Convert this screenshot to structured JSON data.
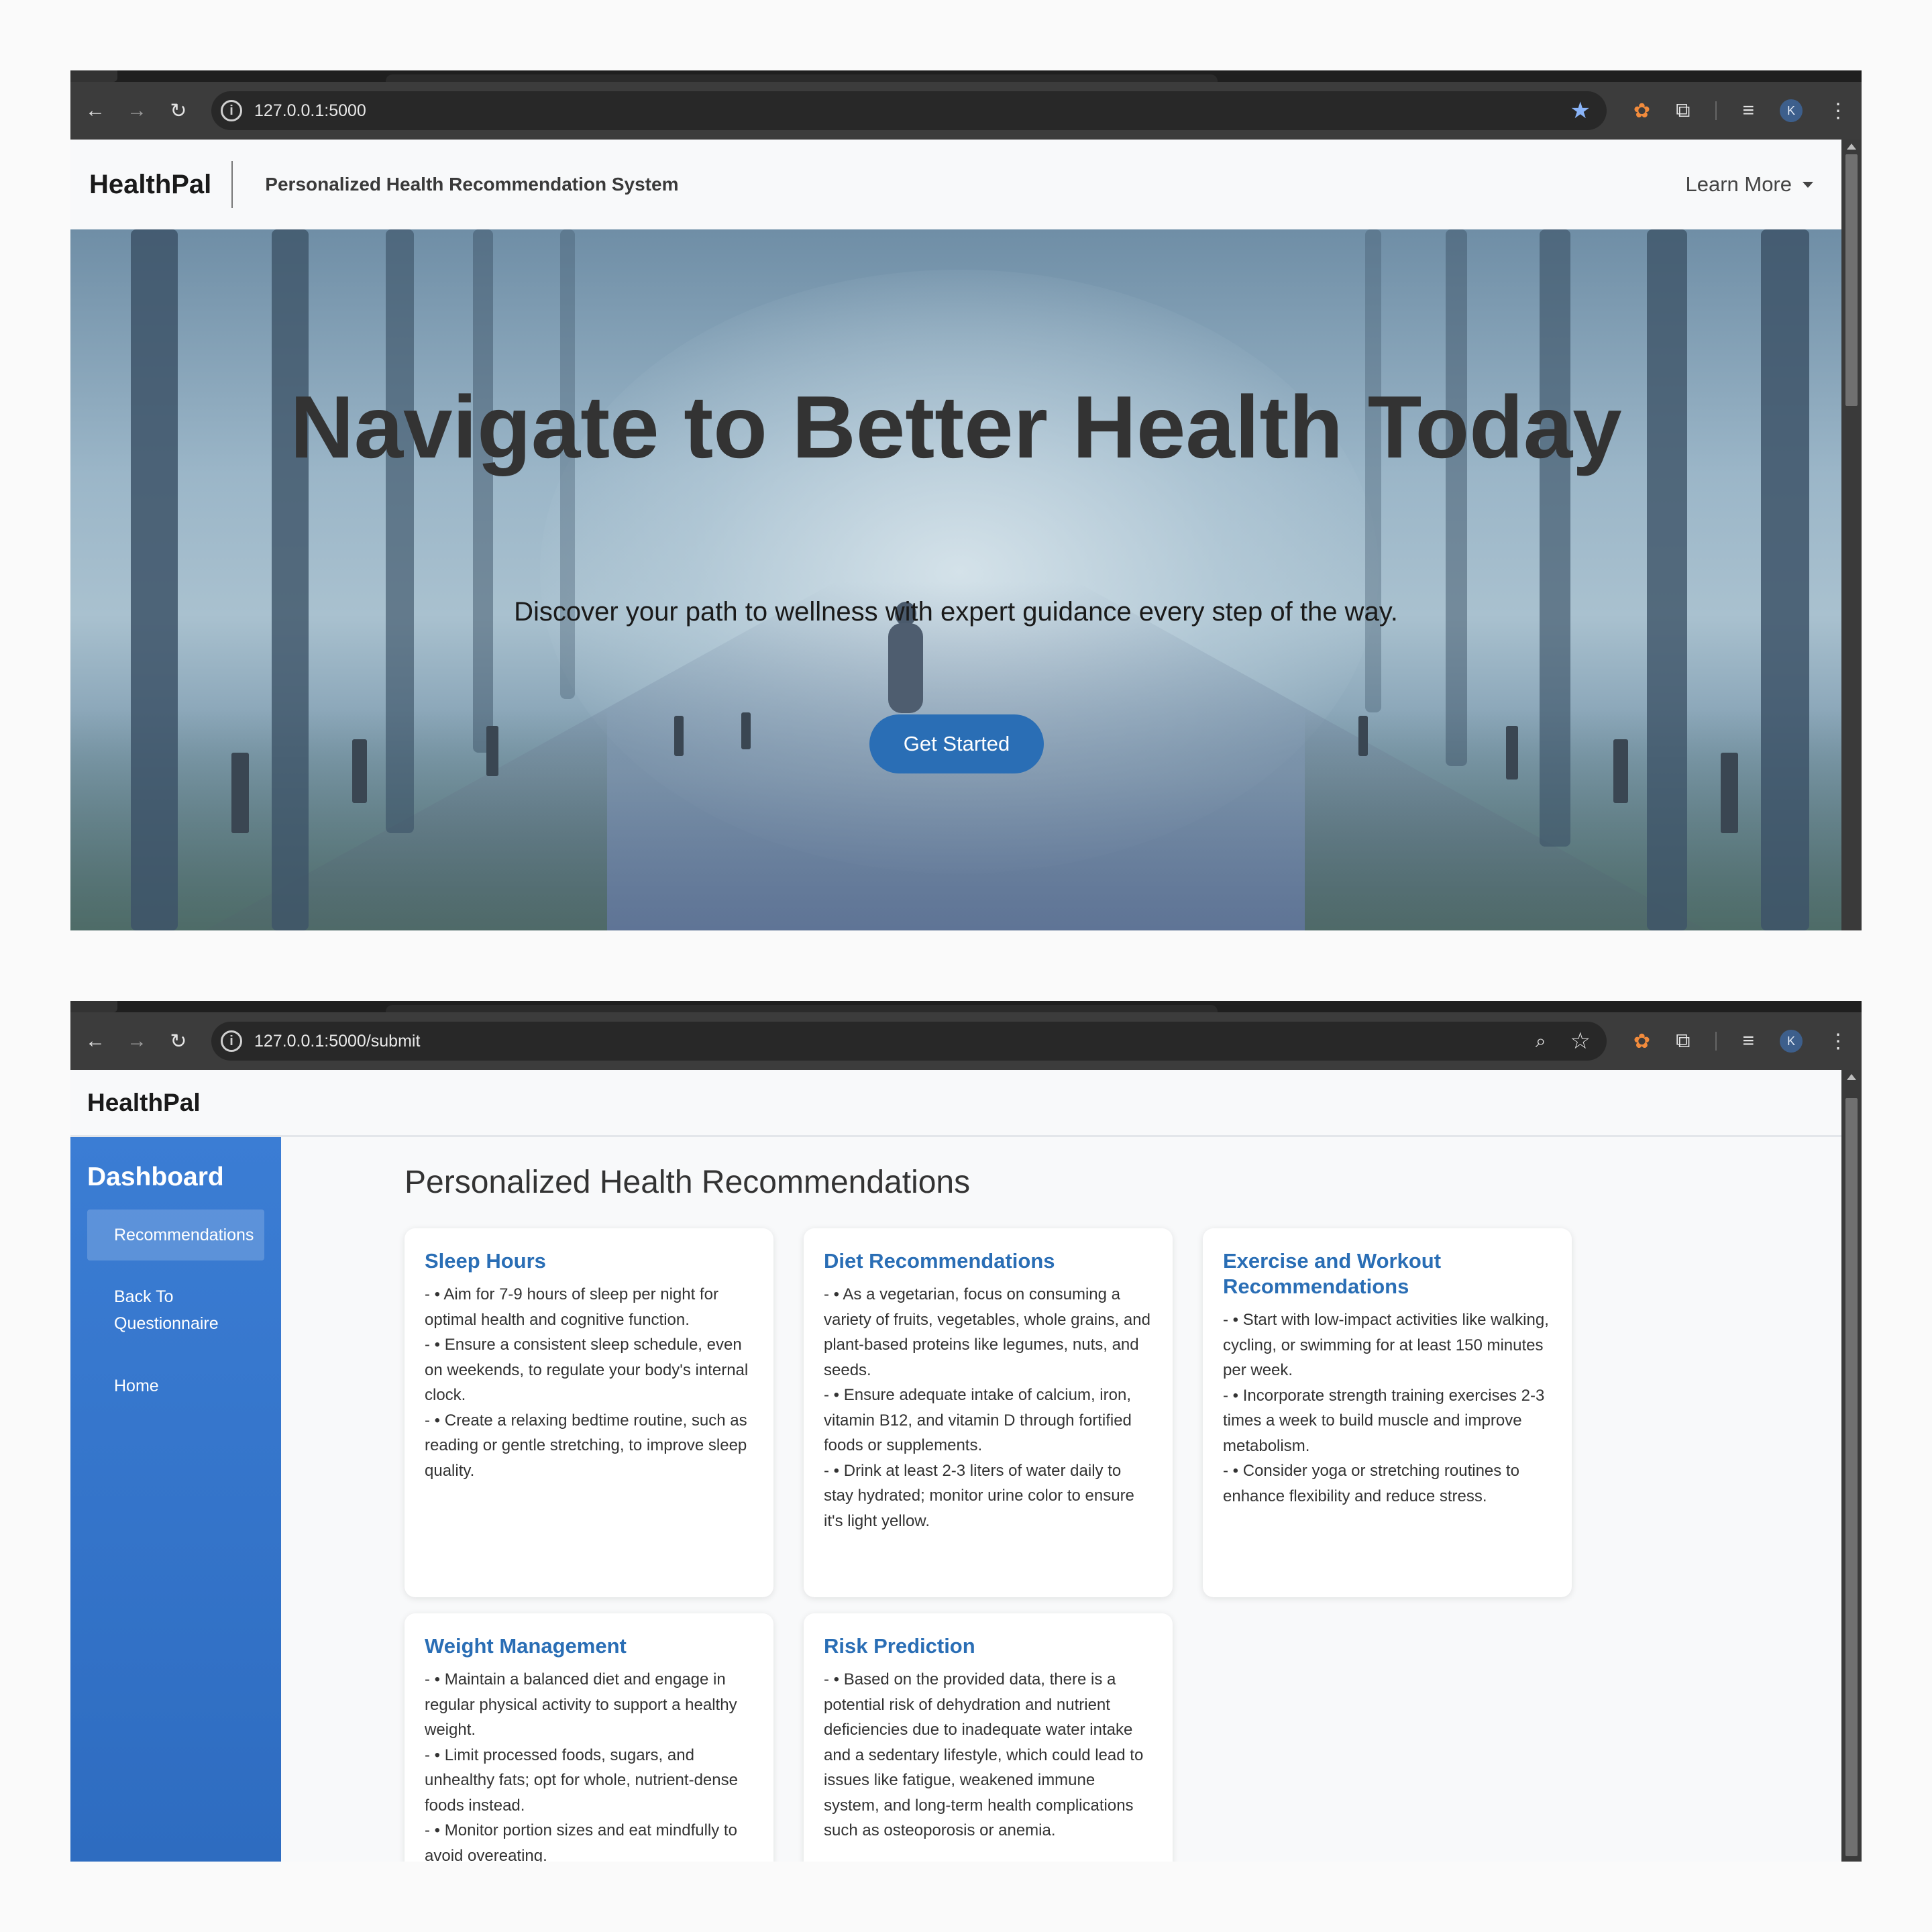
{
  "window1": {
    "url": "127.0.0.1:5000",
    "brand": "HealthPal",
    "tagline": "Personalized Health Recommendation System",
    "learn_more": "Learn More",
    "hero_title": "Navigate to Better Health Today",
    "hero_subtitle": "Discover your path to wellness with expert guidance every step of the way.",
    "cta": "Get Started"
  },
  "window2": {
    "url": "127.0.0.1:5000/submit",
    "brand": "HealthPal",
    "sidebar": {
      "title": "Dashboard",
      "items": [
        {
          "label": "Recommendations"
        },
        {
          "label": "Back To Questionnaire"
        },
        {
          "label": "Home"
        }
      ]
    },
    "main_title": "Personalized Health Recommendations",
    "cards": [
      {
        "title": "Sleep Hours",
        "body": "- • Aim for 7-9 hours of sleep per night for optimal health and cognitive function.\n- • Ensure a consistent sleep schedule, even on weekends, to regulate your body's internal clock.\n- • Create a relaxing bedtime routine, such as reading or gentle stretching, to improve sleep quality."
      },
      {
        "title": "Diet Recommendations",
        "body": "- • As a vegetarian, focus on consuming a variety of fruits, vegetables, whole grains, and plant-based proteins like legumes, nuts, and seeds.\n- • Ensure adequate intake of calcium, iron, vitamin B12, and vitamin D through fortified foods or supplements.\n- • Drink at least 2-3 liters of water daily to stay hydrated; monitor urine color to ensure it's light yellow."
      },
      {
        "title": "Exercise and Workout Recommendations",
        "body": "- • Start with low-impact activities like walking, cycling, or swimming for at least 150 minutes per week.\n- • Incorporate strength training exercises 2-3 times a week to build muscle and improve metabolism.\n- • Consider yoga or stretching routines to enhance flexibility and reduce stress."
      },
      {
        "title": "Weight Management",
        "body": "- • Maintain a balanced diet and engage in regular physical activity to support a healthy weight.\n- • Limit processed foods, sugars, and unhealthy fats; opt for whole, nutrient-dense foods instead.\n- • Monitor portion sizes and eat mindfully to avoid overeating."
      },
      {
        "title": "Risk Prediction",
        "body": "- • Based on the provided data, there is a potential risk of dehydration and nutrient deficiencies due to inadequate water intake and a sedentary lifestyle, which could lead to issues like fatigue, weakened immune system, and long-term health complications such as osteoporosis or anemia."
      }
    ]
  },
  "chrome": {
    "profile_initial": "K",
    "icons": [
      "back-icon",
      "forward-icon",
      "reload-icon",
      "site-info-icon",
      "zoom-icon",
      "bookmark-star-icon",
      "extension-icon",
      "puzzle-icon",
      "media-control-icon",
      "profile-icon",
      "menu-icon"
    ]
  }
}
